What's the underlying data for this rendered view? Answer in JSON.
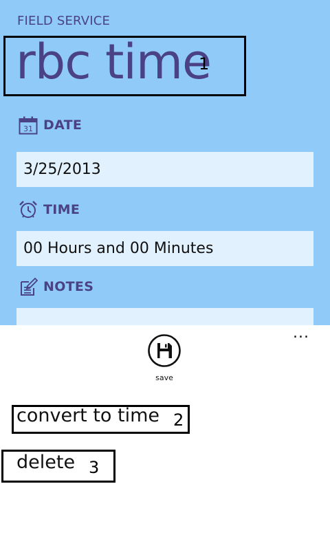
{
  "header": {
    "app_name": "FIELD SERVICE",
    "page_title": "rbc time",
    "callout_1": "1"
  },
  "date_section": {
    "label": "DATE",
    "icon": "calendar-icon",
    "calendar_day": "31",
    "value": "3/25/2013"
  },
  "time_section": {
    "label": "TIME",
    "icon": "alarm-clock-icon",
    "value": "00 Hours and 00 Minutes"
  },
  "notes_section": {
    "label": "NOTES",
    "icon": "notes-icon",
    "value": ""
  },
  "app_bar": {
    "more_label": "...",
    "save_label": "save",
    "save_icon": "save-icon",
    "menu_items": [
      {
        "label": "convert to time",
        "callout": "2"
      },
      {
        "label": "delete",
        "callout": "3"
      }
    ]
  },
  "colors": {
    "page_background": "#8fcaf8",
    "field_background": "#e1f1fd",
    "accent_text": "#4a4285",
    "app_bar_background": "#ffffff"
  }
}
